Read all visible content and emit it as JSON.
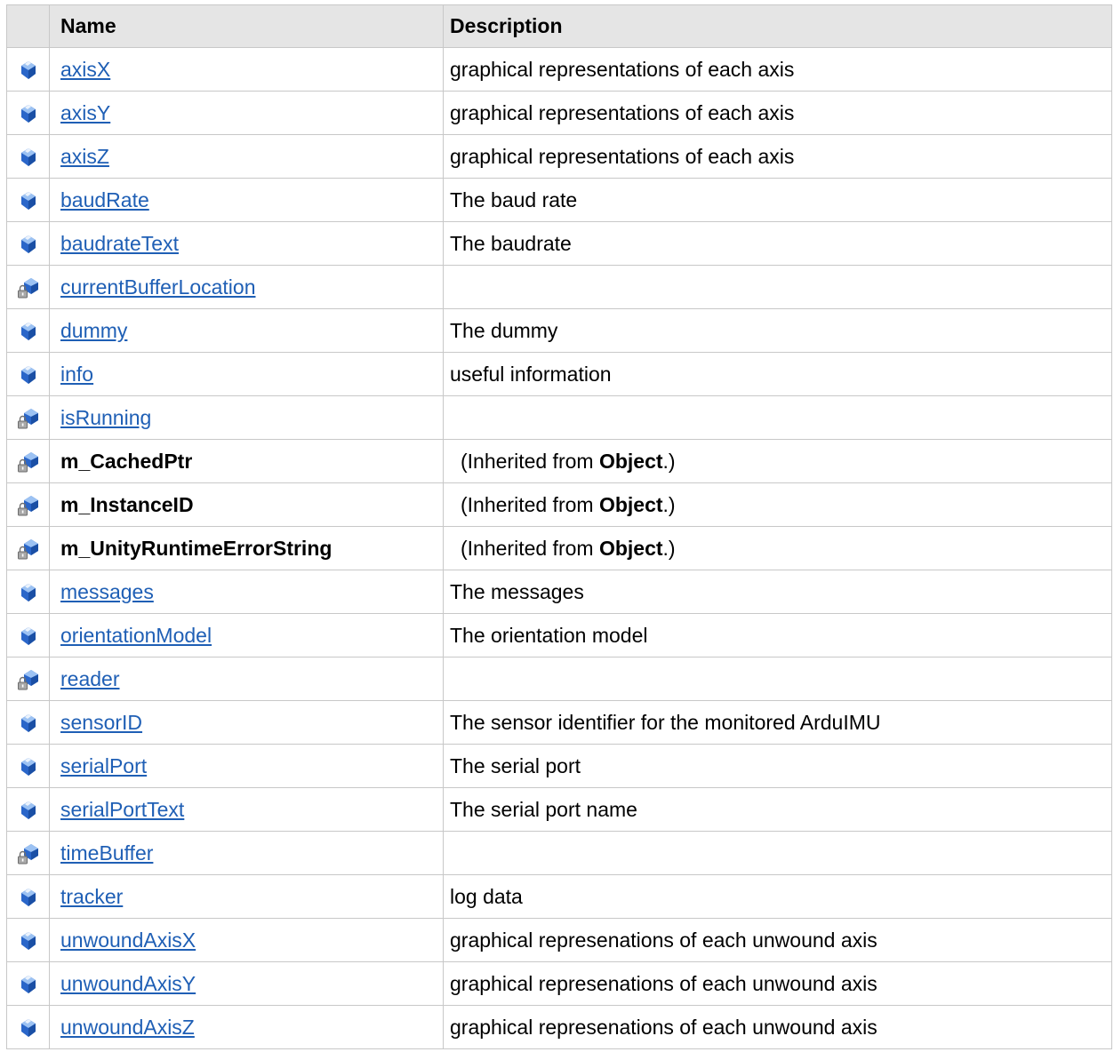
{
  "header": {
    "icon_col": "",
    "name": "Name",
    "description": "Description"
  },
  "rows": [
    {
      "icon": "public-field-icon",
      "name": "axisX",
      "link": true,
      "description": "graphical representations of each axis"
    },
    {
      "icon": "public-field-icon",
      "name": "axisY",
      "link": true,
      "description": "graphical representations of each axis"
    },
    {
      "icon": "public-field-icon",
      "name": "axisZ",
      "link": true,
      "description": "graphical representations of each axis"
    },
    {
      "icon": "public-field-icon",
      "name": "baudRate",
      "link": true,
      "description": "The baud rate"
    },
    {
      "icon": "public-field-icon",
      "name": "baudrateText",
      "link": true,
      "description": "The baudrate"
    },
    {
      "icon": "private-field-icon",
      "name": "currentBufferLocation",
      "link": true,
      "description": ""
    },
    {
      "icon": "public-field-icon",
      "name": "dummy",
      "link": true,
      "description": "The dummy"
    },
    {
      "icon": "public-field-icon",
      "name": "info",
      "link": true,
      "description": "useful information"
    },
    {
      "icon": "private-field-icon",
      "name": "isRunning",
      "link": true,
      "description": ""
    },
    {
      "icon": "private-field-icon",
      "name": "m_CachedPtr",
      "link": false,
      "inherited": {
        "prefix": "(Inherited from ",
        "class": "Object",
        "suffix": ".)"
      }
    },
    {
      "icon": "private-field-icon",
      "name": "m_InstanceID",
      "link": false,
      "inherited": {
        "prefix": "(Inherited from ",
        "class": "Object",
        "suffix": ".)"
      }
    },
    {
      "icon": "private-field-icon",
      "name": "m_UnityRuntimeErrorString",
      "link": false,
      "inherited": {
        "prefix": "(Inherited from ",
        "class": "Object",
        "suffix": ".)"
      }
    },
    {
      "icon": "public-field-icon",
      "name": "messages",
      "link": true,
      "description": "The messages"
    },
    {
      "icon": "public-field-icon",
      "name": "orientationModel",
      "link": true,
      "description": "The orientation model"
    },
    {
      "icon": "private-field-icon",
      "name": "reader",
      "link": true,
      "description": ""
    },
    {
      "icon": "public-field-icon",
      "name": "sensorID",
      "link": true,
      "description": "The sensor identifier for the monitored ArduIMU"
    },
    {
      "icon": "public-field-icon",
      "name": "serialPort",
      "link": true,
      "description": "The serial port"
    },
    {
      "icon": "public-field-icon",
      "name": "serialPortText",
      "link": true,
      "description": "The serial port name"
    },
    {
      "icon": "private-field-icon",
      "name": "timeBuffer",
      "link": true,
      "description": ""
    },
    {
      "icon": "public-field-icon",
      "name": "tracker",
      "link": true,
      "description": "log data"
    },
    {
      "icon": "public-field-icon",
      "name": "unwoundAxisX",
      "link": true,
      "description": "graphical represenations of each unwound axis"
    },
    {
      "icon": "public-field-icon",
      "name": "unwoundAxisY",
      "link": true,
      "description": "graphical represenations of each unwound axis"
    },
    {
      "icon": "public-field-icon",
      "name": "unwoundAxisZ",
      "link": true,
      "description": "graphical represenations of each unwound axis"
    }
  ],
  "colors": {
    "header_bg": "#e5e5e5",
    "border": "#c8c8c8",
    "link": "#1f5fb5",
    "icon_blue": "#2a66c9",
    "lock_gray": "#8a8a8a"
  }
}
